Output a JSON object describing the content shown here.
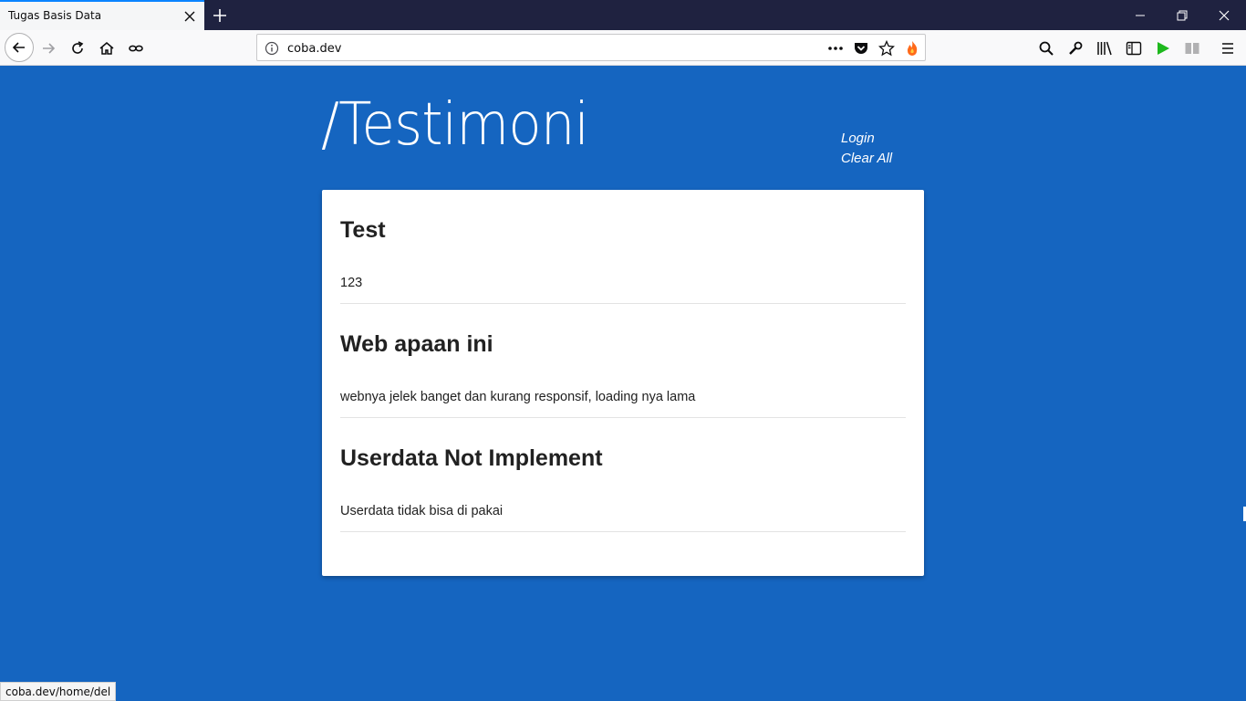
{
  "browser": {
    "tab_title": "Tugas Basis Data",
    "url": "coba.dev",
    "status_url": "coba.dev/home/del"
  },
  "page": {
    "title": "/Testimoni",
    "nav": {
      "login": "Login",
      "clear_all": "Clear All"
    },
    "entries": [
      {
        "title": "Test",
        "body": "123"
      },
      {
        "title": "Web apaan ini",
        "body": "webnya jelek banget dan kurang responsif, loading nya lama"
      },
      {
        "title": "Userdata Not Implement",
        "body": "Userdata tidak bisa di pakai"
      }
    ]
  },
  "colors": {
    "page_background": "#1565c0",
    "card_background": "#ffffff",
    "titlebar": "#1f2240"
  }
}
